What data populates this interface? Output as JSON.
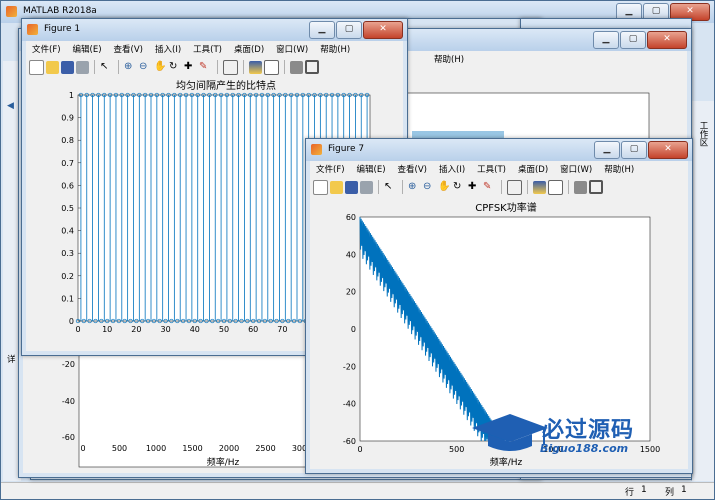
{
  "app": {
    "title": "MATLAB R2018a"
  },
  "back_window": {
    "yticks": [
      "-20",
      "-40",
      "-60"
    ],
    "xticks": [
      "0",
      "500",
      "1000",
      "1500",
      "2000",
      "2500",
      "3000"
    ],
    "xlabel": "频率/Hz",
    "left_label": "详"
  },
  "right_panel": {
    "tab_label": "工作区"
  },
  "statusbar": {
    "row_label": "行",
    "row_value": "1",
    "col_label": "列",
    "col_value": "1"
  },
  "figure1": {
    "title": "Figure 1",
    "menu": [
      "文件(F)",
      "编辑(E)",
      "查看(V)",
      "插入(I)",
      "工具(T)",
      "桌面(D)",
      "窗口(W)",
      "帮助(H)"
    ],
    "menu_extra": "帮助(H)",
    "chart_data": {
      "type": "stem",
      "title": "均匀间隔产生的比特点",
      "xlim": [
        0,
        100
      ],
      "ylim": [
        0,
        1
      ],
      "xticks": [
        "0",
        "10",
        "20",
        "30",
        "40",
        "50",
        "60",
        "70",
        "80"
      ],
      "yticks": [
        "0",
        "0.1",
        "0.2",
        "0.3",
        "0.4",
        "0.5",
        "0.6",
        "0.7",
        "0.8",
        "0.9",
        "1"
      ],
      "color": "#0072bd"
    }
  },
  "figure7": {
    "title": "Figure 7",
    "menu": [
      "文件(F)",
      "编辑(E)",
      "查看(V)",
      "插入(I)",
      "工具(T)",
      "桌面(D)",
      "窗口(W)",
      "帮助(H)"
    ],
    "chart_data": {
      "type": "line",
      "title": "CPFSK功率谱",
      "xlabel": "频率/Hz",
      "xlim": [
        0,
        1500
      ],
      "ylim": [
        -60,
        60
      ],
      "xticks": [
        "0",
        "500",
        "1000",
        "1500"
      ],
      "yticks": [
        "60",
        "40",
        "20",
        "0",
        "-20",
        "-40",
        "-60"
      ],
      "color": "#0072bd"
    }
  },
  "watermark": {
    "text": "必过源码",
    "url": "Biguo188.com"
  }
}
